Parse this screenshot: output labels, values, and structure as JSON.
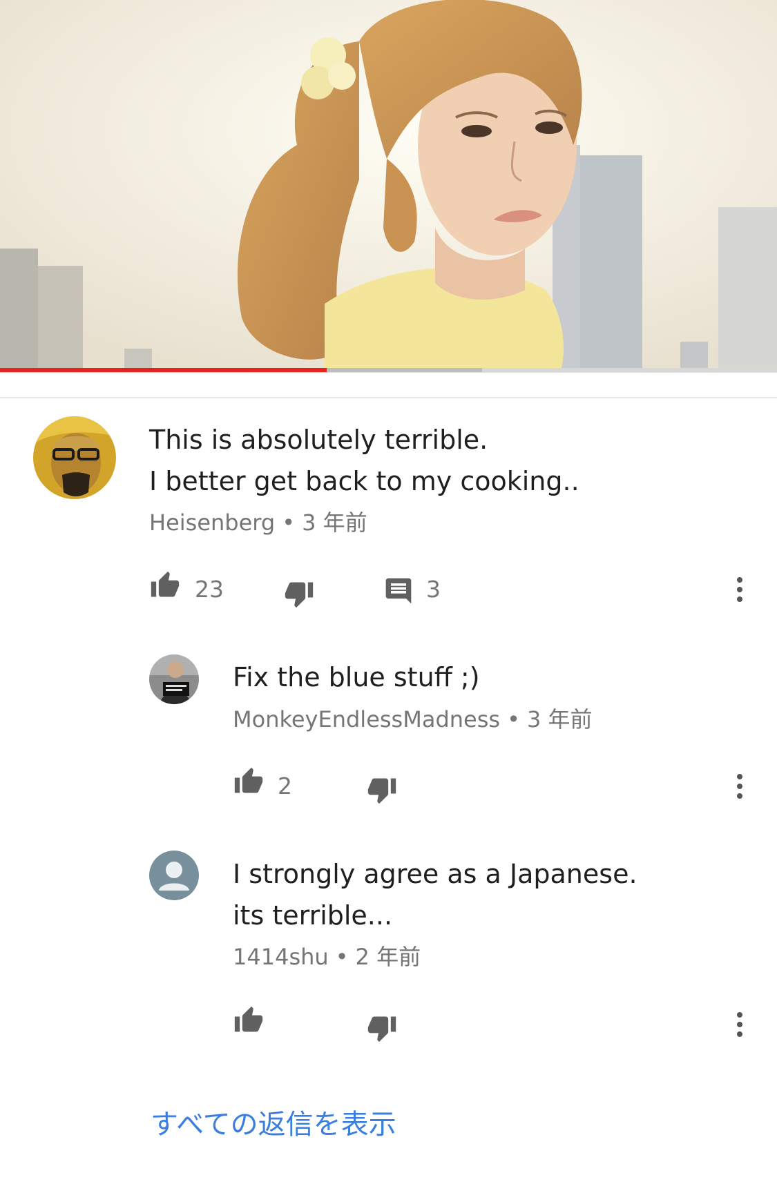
{
  "video": {
    "progress_percent": 42,
    "buffered_percent": 62,
    "progress_color": "#e8231f"
  },
  "comment": {
    "author": "Heisenberg",
    "time": "3 年前",
    "lines": [
      "This is absolutely terrible.",
      "I better get back to my cooking.."
    ],
    "likes": "23",
    "replies_count": "3",
    "avatar_icon": "heisenberg-avatar"
  },
  "replies": [
    {
      "author": "MonkeyEndlessMadness",
      "time": "3 年前",
      "lines": [
        "Fix the blue stuff ;)"
      ],
      "likes": "2",
      "avatar_icon": "mugshot-avatar"
    },
    {
      "author": "1414shu",
      "time": "2 年前",
      "lines": [
        "I strongly agree as a Japanese.",
        "its terrible..."
      ],
      "likes": "",
      "avatar_icon": "default-user-avatar"
    }
  ],
  "separator": "•",
  "show_all_replies": "すべての返信を表示",
  "colors": {
    "link": "#3a7ee0",
    "meta": "#757575",
    "text": "#1f1f1f"
  }
}
